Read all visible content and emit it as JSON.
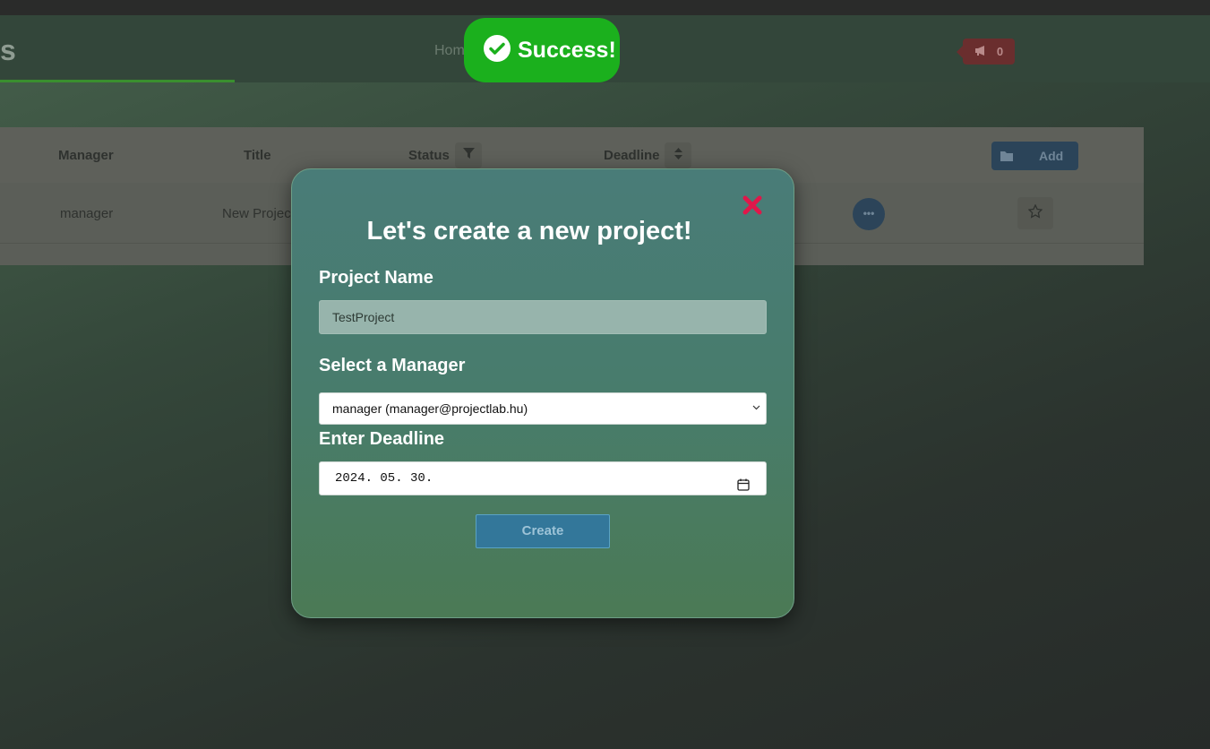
{
  "header": {
    "brand_fragment": "s",
    "nav_home": "Hom",
    "notifications_count": "0"
  },
  "table": {
    "columns": {
      "manager": "Manager",
      "title": "Title",
      "status": "Status",
      "deadline": "Deadline"
    },
    "add_label": "Add",
    "rows": [
      {
        "manager": "manager",
        "title": "New Projec"
      }
    ]
  },
  "toast": {
    "text": "Success!"
  },
  "modal": {
    "title": "Let's create a new project!",
    "project_name_label": "Project Name",
    "project_name_value": "TestProject",
    "manager_label": "Select a Manager",
    "manager_selected": "manager (manager@projectlab.hu)",
    "deadline_label": "Enter Deadline",
    "deadline_value": "2024. 05. 30.",
    "create_label": "Create"
  },
  "colors": {
    "toast_bg": "#1bb01d",
    "modal_bg": "#487c6c",
    "close_icon": "#e0174a",
    "create_btn": "#33779a"
  },
  "icons": [
    "filter-icon",
    "sort-icon",
    "folder-icon",
    "megaphone-icon",
    "more-icon",
    "star-icon",
    "close-icon",
    "check-circle-icon",
    "calendar-icon",
    "chevron-down-icon"
  ]
}
